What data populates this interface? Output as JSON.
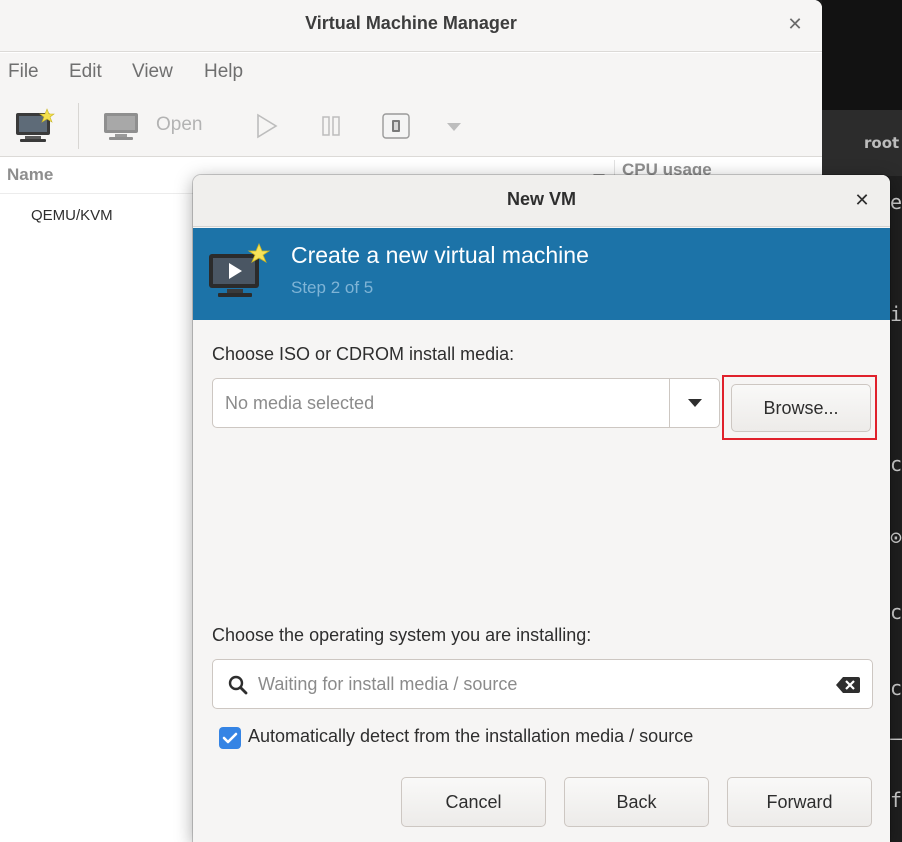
{
  "manager": {
    "title": "Virtual Machine Manager",
    "menu": [
      "File",
      "Edit",
      "View",
      "Help"
    ],
    "toolbar": {
      "open_label": "Open"
    },
    "columns": {
      "name": "Name",
      "cpu": "CPU usage"
    },
    "connections": [
      "QEMU/KVM"
    ]
  },
  "terminal": {
    "title": "root",
    "chars": [
      "e",
      "i",
      "c",
      "⊙",
      "c",
      "c",
      "–",
      "f"
    ]
  },
  "dialog": {
    "title": "New VM",
    "banner": {
      "title": "Create a new virtual machine",
      "step": "Step 2 of 5"
    },
    "media": {
      "label": "Choose ISO or CDROM install media:",
      "placeholder": "No media selected",
      "browse_label": "Browse..."
    },
    "os": {
      "label": "Choose the operating system you are installing:",
      "placeholder": "Waiting for install media / source",
      "auto_detect_label": "Automatically detect from the installation media / source",
      "auto_detect_checked": true
    },
    "buttons": {
      "cancel": "Cancel",
      "back": "Back",
      "forward": "Forward"
    }
  },
  "colors": {
    "banner": "#1c73a8",
    "accent": "#3584e4",
    "highlight": "#e0212b"
  }
}
